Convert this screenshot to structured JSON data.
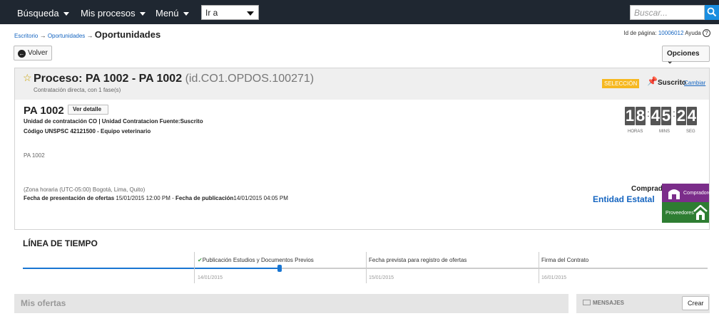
{
  "topbar": {
    "menu": [
      "Búsqueda",
      "Mis procesos",
      "Menú"
    ],
    "goto_value": "Ir a",
    "search_placeholder": "Buscar..."
  },
  "breadcrumb": {
    "items": [
      "Escritorio",
      "Oportunidades"
    ],
    "current": "Oportunidades"
  },
  "page_id": {
    "label": "Id de página:",
    "value": "10006012",
    "help": "Ayuda"
  },
  "actions": {
    "back": "Volver",
    "options": "Opciones"
  },
  "process": {
    "title": "Proceso: PA 1002 - PA 1002",
    "id": "(id.CO1.OPDOS.100271)",
    "subtitle": "Contratación directa, con 1 fase(s)",
    "status_badge": "SELECCIÓN",
    "subscribed": "Suscrito",
    "change": "Cambiar",
    "name": "PA 1002",
    "detail_button": "Ver detalle",
    "unit": "Unidad de contratación CO | Unidad Contratacion Fuente:Suscrito",
    "unspsc": "Código UNSPSC 42121500 - Equipo veterinario",
    "description": "PA 1002",
    "timezone": "(Zona horaria (UTC-05:00) Bogotá, Lima, Quito)",
    "offer_label": "Fecha de presentación de ofertas",
    "offer_date": "15/01/2015 12:00 PM",
    "dash": "-",
    "pub_label": "Fecha de publicación",
    "pub_date": "14/01/2015 04:05 PM",
    "buyer_label": "Comprador:",
    "buyer": "Entidad Estatal",
    "badge_buyers": "Compradores",
    "badge_suppliers": "Proveedores",
    "accent": "#f6b820"
  },
  "timer": {
    "hours": [
      "1",
      "8"
    ],
    "mins": [
      "4",
      "5"
    ],
    "secs": [
      "2",
      "4"
    ],
    "hours_label": "HORAS",
    "mins_label": "MINS",
    "secs_label": "SEG"
  },
  "timeline": {
    "title": "LÍNEA DE TIEMPO",
    "progress": 0.375,
    "steps": [
      {
        "label": "Publicación Estudios y Documentos Previos",
        "date": "14/01/2015"
      },
      {
        "label": "Fecha prevista para registro de ofertas",
        "date": "15/01/2015"
      },
      {
        "label": "Firma del Contrato",
        "date": "16/01/2015"
      }
    ]
  },
  "bottom": {
    "offers": "Mis ofertas",
    "messages": "MENSAJES",
    "create": "Crear"
  }
}
